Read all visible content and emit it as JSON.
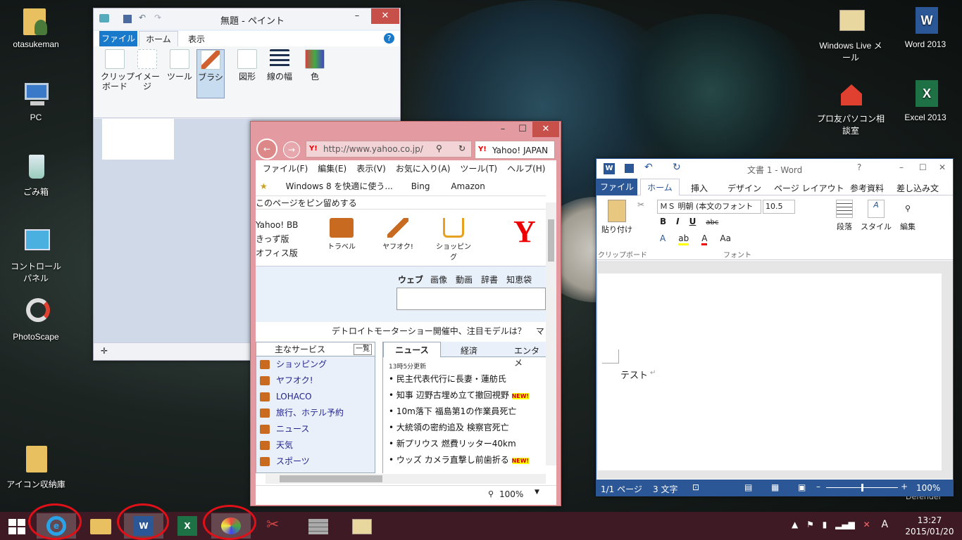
{
  "desktop": {
    "icons_left": [
      {
        "name": "user-folder-icon",
        "label": "otasukeman"
      },
      {
        "name": "pc-icon",
        "label": "PC"
      },
      {
        "name": "recycle-bin-icon",
        "label": "ごみ箱"
      },
      {
        "name": "control-panel-icon",
        "label": "コントロール パネル"
      },
      {
        "name": "photoscape-icon",
        "label": "PhotoScape"
      },
      {
        "name": "icon-storage-folder-icon",
        "label": "アイコン収納庫"
      }
    ],
    "icons_right": [
      {
        "name": "windows-live-mail-icon",
        "label": "Windows Live メール"
      },
      {
        "name": "word-2013-icon",
        "label": "Word 2013"
      },
      {
        "name": "pc-consult-icon",
        "label": "プロ友パソコン相談室"
      },
      {
        "name": "excel-2013-icon",
        "label": "Excel 2013"
      }
    ],
    "defender_text": "Defender"
  },
  "paint": {
    "title": "無題 - ペイント",
    "tabs": [
      "ファイル",
      "ホーム",
      "表示"
    ],
    "groups": [
      {
        "label": "クリップ\nボード",
        "icon": "clipboard-icon"
      },
      {
        "label": "イメージ",
        "icon": "image-select-icon"
      },
      {
        "label": "ツール",
        "icon": "tools-icon"
      },
      {
        "label": "ブラシ",
        "icon": "brush-icon"
      },
      {
        "label": "図形",
        "icon": "shapes-icon"
      },
      {
        "label": "線の幅",
        "icon": "line-width-icon"
      },
      {
        "label": "色",
        "icon": "color-icon"
      }
    ]
  },
  "ie": {
    "url": "http://www.yahoo.co.jp/",
    "tab_title": "Yahoo! JAPAN",
    "menu": [
      "ファイル(F)",
      "編集(E)",
      "表示(V)",
      "お気に入り(A)",
      "ツール(T)",
      "ヘルプ(H)"
    ],
    "favorites": [
      "Windows 8 を快適に使う...",
      "Bing",
      "Amazon"
    ],
    "pin_text": "このページをピン留めする",
    "yahoo_links": [
      "Yahoo! BB",
      "きっず版",
      "オフィス版"
    ],
    "top_services": [
      "トラベル",
      "ヤフオク!",
      "ショッピング"
    ],
    "search_tabs": [
      "ウェブ",
      "画像",
      "動画",
      "辞書",
      "知恵袋"
    ],
    "headline": "デトロイトモーターショー開催中、注目モデルは？",
    "headline_more": "マ",
    "services_title": "主なサービス",
    "services_btn": "一覧",
    "services": [
      "ショッピング",
      "ヤフオク!",
      "LOHACO",
      "旅行、ホテル予約",
      "ニュース",
      "天気",
      "スポーツ"
    ],
    "news_tabs": [
      "ニュース",
      "経済",
      "エンタメ"
    ],
    "news_updated": "13時5分更新",
    "news": [
      "民主代表代行に長妻・蓮舫氏",
      "知事 辺野古埋め立て撤回視野",
      "10m落下 福島第1の作業員死亡",
      "大統領の密約追及 検察官死亡",
      "新プリウス 燃費リッター40km",
      "ウッズ カメラ直撃し前歯折る"
    ],
    "new_badge": "NEW!",
    "zoom": "100%"
  },
  "word": {
    "title": "文書 1 - Word",
    "tabs": [
      "ファイル",
      "ホーム",
      "挿入",
      "デザイン",
      "ページ レイアウト",
      "参考資料",
      "差し込み文"
    ],
    "paste": "貼り付け",
    "clipboard": "クリップボード",
    "font_name": "ＭＳ 明朝 (本文のフォント",
    "font_size": "10.5",
    "font_group": "フォント",
    "paragraph": "段落",
    "style": "スタイル",
    "edit": "編集",
    "doc_text": "テスト",
    "status_page": "1/1 ページ",
    "status_chars": "3 文字",
    "zoom": "100%"
  },
  "taskbar": {
    "time": "13:27",
    "date": "2015/01/20",
    "ime": "A"
  }
}
